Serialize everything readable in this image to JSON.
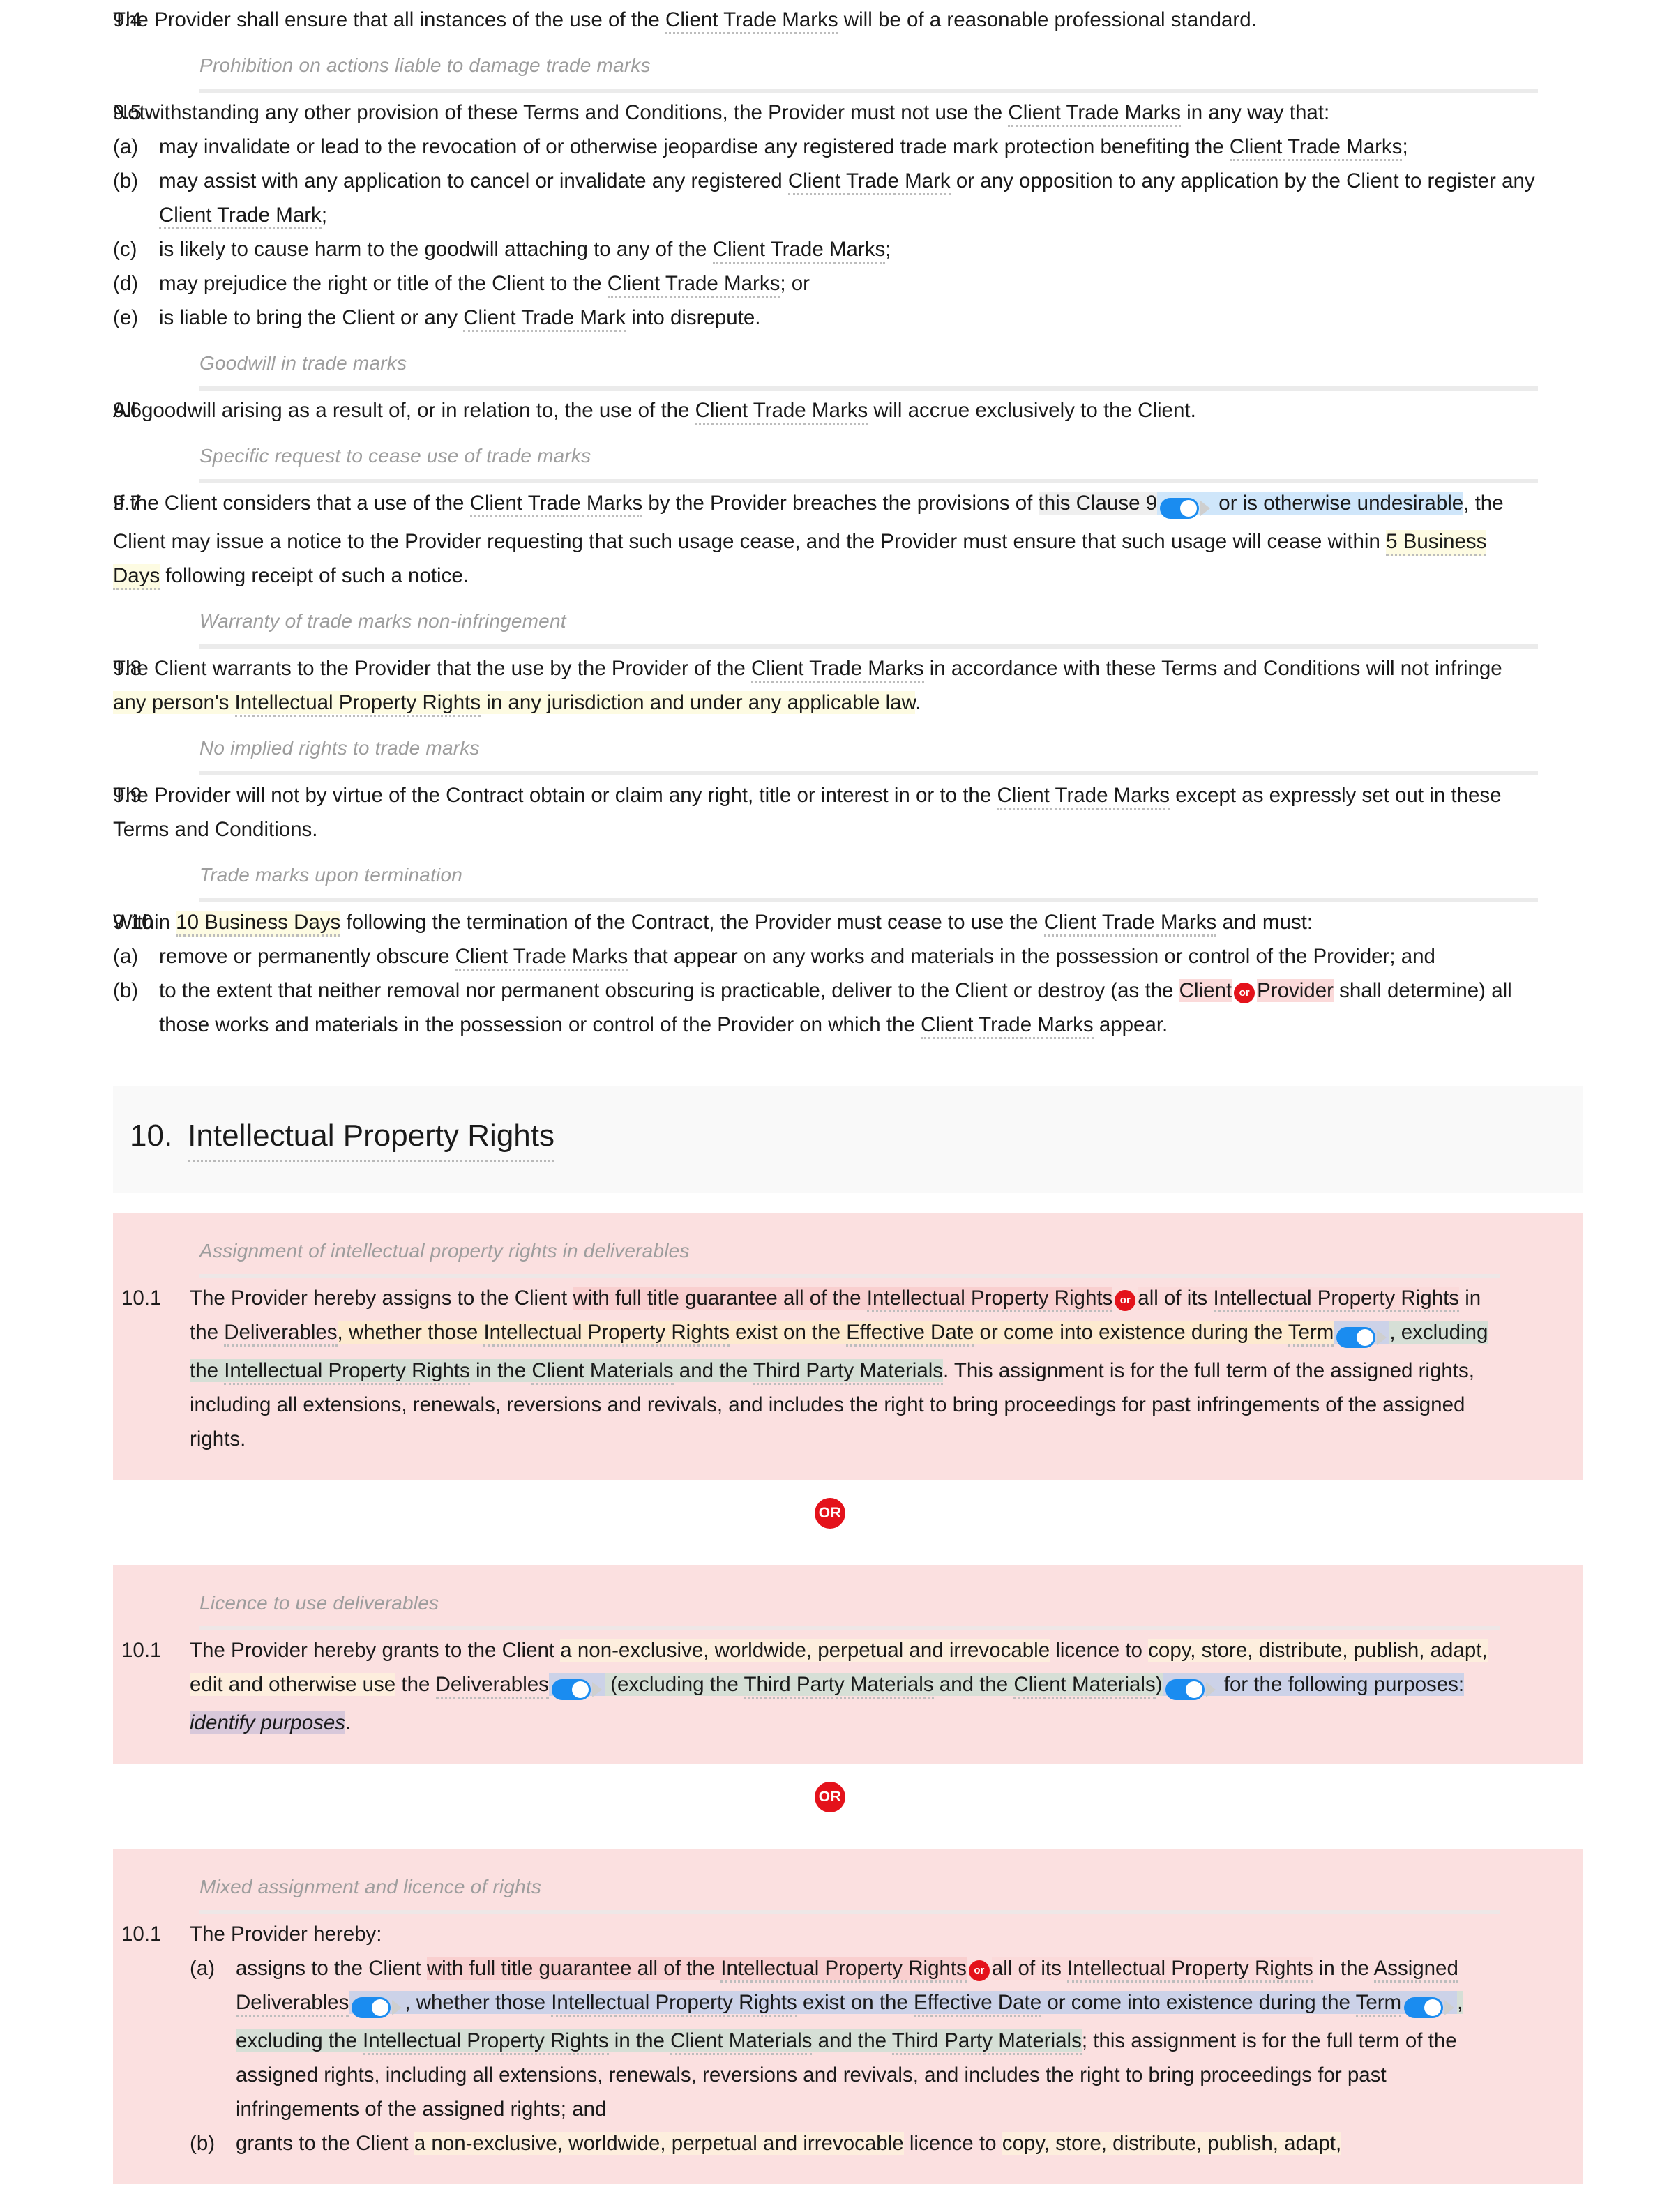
{
  "colors": {
    "or_badge": "#e4121b",
    "toggle_on": "#1a8cf0",
    "variant_block": "#fbe0e0",
    "section_banner": "#f9f9f9",
    "optional_blue": "#cfe6fa",
    "variable_yellow": "#fdfbe2",
    "option_pink": "#f9cfcf",
    "option_peach": "#fdeacf",
    "option_green": "#d6dfd6",
    "option_lavender": "#ccd2e8",
    "option_purple": "#d8c8da"
  },
  "icons": {
    "toggle": "toggle-switch-on",
    "or_badge": "or-circle-badge",
    "caret": "caret-right-icon"
  },
  "clause_9_4": {
    "num": "9.4",
    "t1": "The Provider shall ensure that all instances of the use of the ",
    "term1": "Client Trade Marks",
    "t2": " will be of a reasonable professional standard."
  },
  "subhead_prohibition": "Prohibition on actions liable to damage trade marks",
  "clause_9_5": {
    "num": "9.5",
    "t1": "Notwithstanding any other provision of these Terms and Conditions, the Provider must not use the ",
    "term1": "Client Trade Marks",
    "t2": " in any way that:",
    "items": [
      {
        "marker": "(a)",
        "t1": "may invalidate or lead to the revocation of or otherwise jeopardise any registered trade mark protection benefiting the ",
        "term": "Client Trade Marks",
        "t2": ";"
      },
      {
        "marker": "(b)",
        "t1": "may assist with any application to cancel or invalidate any registered ",
        "term": "Client Trade Mark",
        "t2": " or any opposition to any application by the Client to register any ",
        "term2": "Client Trade Mark",
        "t3": ";"
      },
      {
        "marker": "(c)",
        "t1": "is likely to cause harm to the goodwill attaching to any of the ",
        "term": "Client Trade Marks",
        "t2": ";"
      },
      {
        "marker": "(d)",
        "t1": "may prejudice the right or title of the Client to the ",
        "term": "Client Trade Marks",
        "t2": "; or"
      },
      {
        "marker": "(e)",
        "t1": "is liable to bring the Client or any ",
        "term": "Client Trade Mark",
        "t2": " into disrepute."
      }
    ]
  },
  "subhead_goodwill": "Goodwill in trade marks",
  "clause_9_6": {
    "num": "9.6",
    "t1": "All goodwill arising as a result of, or in relation to, the use of the ",
    "term1": "Client Trade Marks",
    "t2": " will accrue exclusively to the Client."
  },
  "subhead_cease": "Specific request to cease use of trade marks",
  "clause_9_7": {
    "num": "9.7",
    "t1": "If the Client considers that a use of the ",
    "term1": "Client Trade Marks",
    "t2": " by the Provider breaches the provisions of ",
    "grey": "this Clause 9",
    "opt_blue_tail": " or is otherwise undesirable",
    "t3": ", the Client may issue a notice to the Provider requesting that such usage cease, and the Provider must ensure that such usage will cease within ",
    "var1": "5 Business Days",
    "t4": " following receipt of such a notice."
  },
  "subhead_warranty": "Warranty of trade marks non-infringement",
  "clause_9_8": {
    "num": "9.8",
    "t1": "The Client warrants to the Provider that the use by the Provider of the ",
    "term1": "Client Trade Marks",
    "t2": " in accordance with these Terms and Conditions will not infringe ",
    "opt1_a": "any person's ",
    "opt1_term": "Intellectual Property Rights",
    "opt1_b": " in any jurisdiction and under any applicable law",
    "t3": "."
  },
  "subhead_noimplied": "No implied rights to trade marks",
  "clause_9_9": {
    "num": "9.9",
    "t1": "The Provider will not by virtue of the Contract obtain or claim any right, title or interest in or to the ",
    "term1": "Client Trade Marks",
    "t2": " except as expressly set out in these Terms and Conditions."
  },
  "subhead_termination": "Trade marks upon termination",
  "clause_9_10": {
    "num": "9.10",
    "t1": "Within ",
    "var1": "10 Business Days",
    "t2": " following the termination of the Contract, the Provider must cease to use the ",
    "term1": "Client Trade Marks",
    "t3": " and must:",
    "items": [
      {
        "marker": "(a)",
        "t1": "remove or permanently obscure ",
        "term": "Client Trade Marks",
        "t2": " that appear on any works and materials in the possession or control of the Provider; and"
      },
      {
        "marker": "(b)",
        "t1": "to the extent that neither removal nor permanent obscuring is practicable, deliver to the Client or destroy (as the ",
        "opt_a": "Client",
        "or_chip": "or",
        "opt_b": "Provider",
        "t2": " shall determine) all those works and materials in the possession or control of the Provider on which the ",
        "term2": "Client Trade Marks",
        "t3": " appear."
      }
    ]
  },
  "section_10": {
    "num": "10.",
    "title": "Intellectual Property Rights"
  },
  "variant_a": {
    "subhead": "Assignment of intellectual property rights in deliverables",
    "num": "10.1",
    "t1": "The Provider hereby assigns to the Client ",
    "optA": "with full title guarantee all of the ",
    "optA_term": "Intellectual Property Rights",
    "or_chip": "or",
    "optB": "all of its ",
    "optB_term": "Intellectual Property Rights",
    "t2": " in the ",
    "term_deliverables": "Deliverables",
    "optC_a": ", whether those ",
    "optC_term1": "Intellectual Property Rights",
    "optC_b": " exist on the ",
    "optC_term2": "Effective Date",
    "optC_c": " or come into existence during the ",
    "optC_term3": "Term",
    "toggle1": "toggle-switch-on",
    "optD_a": ", excluding the ",
    "optD_term1": "Intellectual Property Rights",
    "optD_b": " in the ",
    "optD_term2": "Client Materials",
    "optD_c": " and the ",
    "optD_term3": "Third Party Materials",
    "t3": ". This assignment is for the full term of the assigned rights, including all extensions, renewals, reversions and revivals, and includes the right to bring proceedings for past infringements of the assigned rights."
  },
  "or_divider_1": "OR",
  "variant_b": {
    "subhead": "Licence to use deliverables",
    "num": "10.1",
    "t1": "The Provider hereby grants to the Client ",
    "optA": "a non-exclusive, worldwide, perpetual and irrevocable",
    "t2": " licence to ",
    "optB": "copy, store, distribute, publish, adapt, edit and otherwise use",
    "t3": " the ",
    "term_deliverables": "Deliverables",
    "toggle1": "toggle-switch-on",
    "optC_a": " (excluding the ",
    "optC_term1": "Third Party Materials",
    "optC_b": " and the ",
    "optC_term2": "Client Materials",
    "optC_c": ")",
    "toggle2": "toggle-switch-on",
    "optD": " for the following purposes: ",
    "optD_var": "identify purposes",
    "t4": "."
  },
  "or_divider_2": "OR",
  "variant_c": {
    "subhead": "Mixed assignment and licence of rights",
    "num": "10.1",
    "lead": "The Provider hereby:",
    "item_a": {
      "marker": "(a)",
      "t1": "assigns to the Client ",
      "optA": "with full title guarantee all of the ",
      "optA_term": "Intellectual Property Rights",
      "or_chip": "or",
      "optB": "all of its ",
      "optB_term": "Intellectual Property Rights",
      "t2": " in the ",
      "term_assigned": "Assigned Deliverables",
      "toggle1": "toggle-switch-on",
      "optC_a": ", whether those ",
      "optC_term1": "Intellectual Property Rights",
      "optC_b": " exist on the ",
      "optC_term2": "Effective Date",
      "optC_c": " or come into existence during the ",
      "optC_term3": "Term",
      "toggle2": "toggle-switch-on",
      "optD_a": ", excluding the ",
      "optD_term1": "Intellectual Property Rights",
      "optD_b": " in the ",
      "optD_term2": "Client Materials",
      "optD_c": " and the ",
      "optD_term3": "Third Party Materials",
      "t3": "; this assignment is for the full term of the assigned rights, including all extensions, renewals, reversions and revivals, and includes the right to bring proceedings for past infringements of the assigned rights; and"
    },
    "item_b": {
      "marker": "(b)",
      "t1": "grants to the Client ",
      "optA": "a non-exclusive, worldwide, perpetual and irrevocable",
      "t2": " licence to ",
      "optB": "copy, store, distribute, publish, adapt,"
    }
  }
}
